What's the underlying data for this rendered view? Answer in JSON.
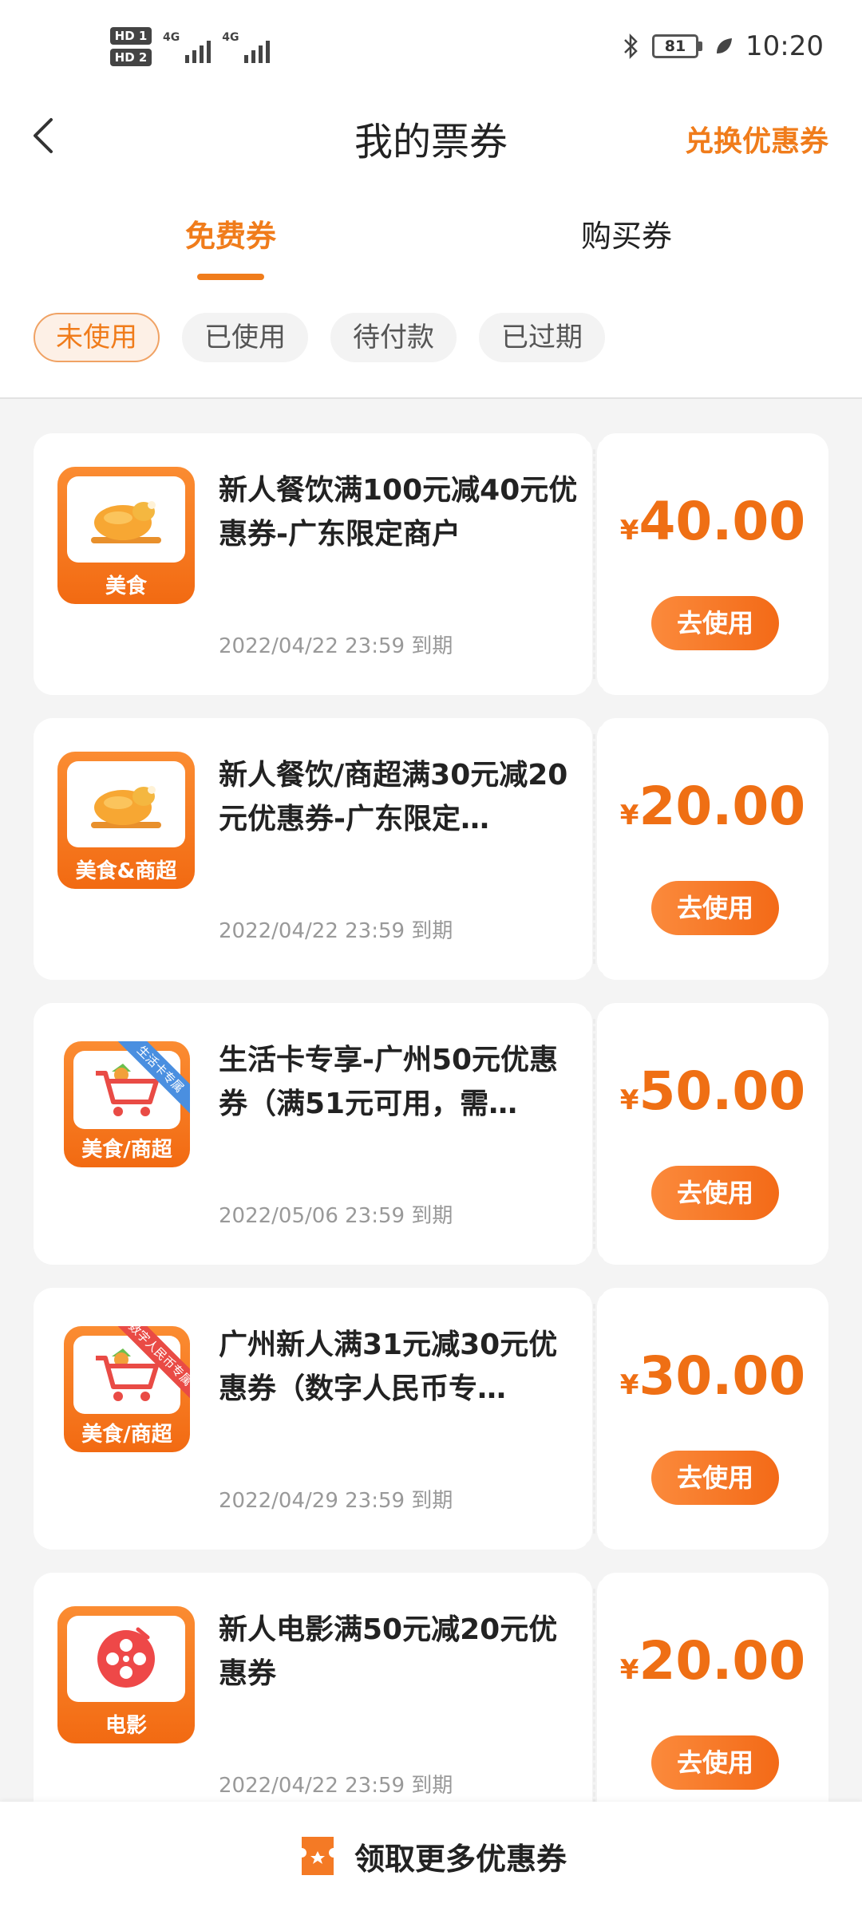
{
  "status_bar": {
    "time": "10:20",
    "battery": "81",
    "sim1": "HD 1",
    "sim2": "HD 2",
    "network1": "4G",
    "network2": "4G"
  },
  "nav": {
    "title": "我的票券",
    "right_action": "兑换优惠券"
  },
  "tabs": [
    {
      "label": "免费券",
      "active": true
    },
    {
      "label": "购买券",
      "active": false
    }
  ],
  "filters": [
    {
      "label": "未使用",
      "active": true
    },
    {
      "label": "已使用",
      "active": false
    },
    {
      "label": "待付款",
      "active": false
    },
    {
      "label": "已过期",
      "active": false
    }
  ],
  "coupons": [
    {
      "icon": "roast-chicken-icon",
      "category": "美食",
      "title": "新人餐饮满100元减40元优惠券-广东限定商户",
      "expiry": "2022/04/22 23:59 到期",
      "currency": "¥",
      "amount": "40.00",
      "button": "去使用"
    },
    {
      "icon": "roast-chicken-icon",
      "category": "美食&商超",
      "title": "新人餐饮/商超满30元减20元优惠券-广东限定…",
      "expiry": "2022/04/22 23:59 到期",
      "currency": "¥",
      "amount": "20.00",
      "button": "去使用"
    },
    {
      "icon": "shopping-cart-icon",
      "category": "美食/商超",
      "ribbon": "生活卡专属",
      "title": "生活卡专享-广州50元优惠券（满51元可用，需…",
      "expiry": "2022/05/06 23:59 到期",
      "currency": "¥",
      "amount": "50.00",
      "button": "去使用"
    },
    {
      "icon": "shopping-cart-icon",
      "category": "美食/商超",
      "ribbon": "数字人民币专属",
      "title": "广州新人满31元减30元优惠券（数字人民币专…",
      "expiry": "2022/04/29 23:59 到期",
      "currency": "¥",
      "amount": "30.00",
      "button": "去使用"
    },
    {
      "icon": "film-reel-icon",
      "category": "电影",
      "title": "新人电影满50元减20元优惠券",
      "expiry": "2022/04/22 23:59 到期",
      "currency": "¥",
      "amount": "20.00",
      "button": "去使用"
    }
  ],
  "bottom": {
    "label": "领取更多优惠券",
    "icon": "ticket-icon"
  },
  "colors": {
    "accent": "#f07c1b",
    "background": "#f4f4f4",
    "blue_ribbon": "#4a8fe0",
    "red_ribbon": "#e94b45"
  }
}
